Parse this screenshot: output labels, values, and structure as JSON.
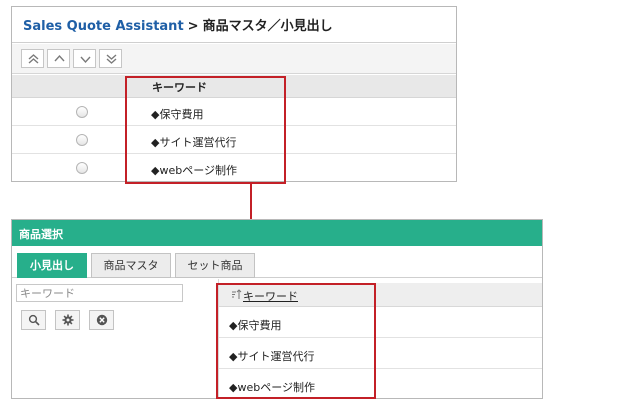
{
  "top_panel": {
    "breadcrumb": {
      "app": "Sales Quote Assistant",
      "separator": ">",
      "page": "商品マスタ／小見出し"
    },
    "nav_buttons": [
      {
        "name": "move-to-top",
        "icon": "double-chevron-up-icon"
      },
      {
        "name": "move-up",
        "icon": "chevron-up-icon"
      },
      {
        "name": "move-down",
        "icon": "chevron-down-icon"
      },
      {
        "name": "move-to-bottom",
        "icon": "double-chevron-down-icon"
      }
    ],
    "column_header": "キーワード",
    "rows": [
      {
        "keyword": "◆保守費用"
      },
      {
        "keyword": "◆サイト運営代行"
      },
      {
        "keyword": "◆webページ制作"
      }
    ]
  },
  "bottom_panel": {
    "title": "商品選択",
    "tabs": [
      {
        "label": "小見出し",
        "active": true
      },
      {
        "label": "商品マスタ",
        "active": false
      },
      {
        "label": "セット商品",
        "active": false
      }
    ],
    "search": {
      "placeholder": "キーワード",
      "value": ""
    },
    "buttons": [
      {
        "name": "search-button",
        "icon": "search-icon"
      },
      {
        "name": "settings-button",
        "icon": "gear-icon"
      },
      {
        "name": "clear-button",
        "icon": "close-circle-icon"
      }
    ],
    "column_header": "キーワード",
    "rows": [
      {
        "keyword": "◆保守費用"
      },
      {
        "keyword": "◆サイト運営代行"
      },
      {
        "keyword": "◆webページ制作"
      }
    ]
  },
  "colors": {
    "accent_green": "#27af8b",
    "highlight_red": "#c32027",
    "breadcrumb_blue": "#1f5fa6"
  }
}
